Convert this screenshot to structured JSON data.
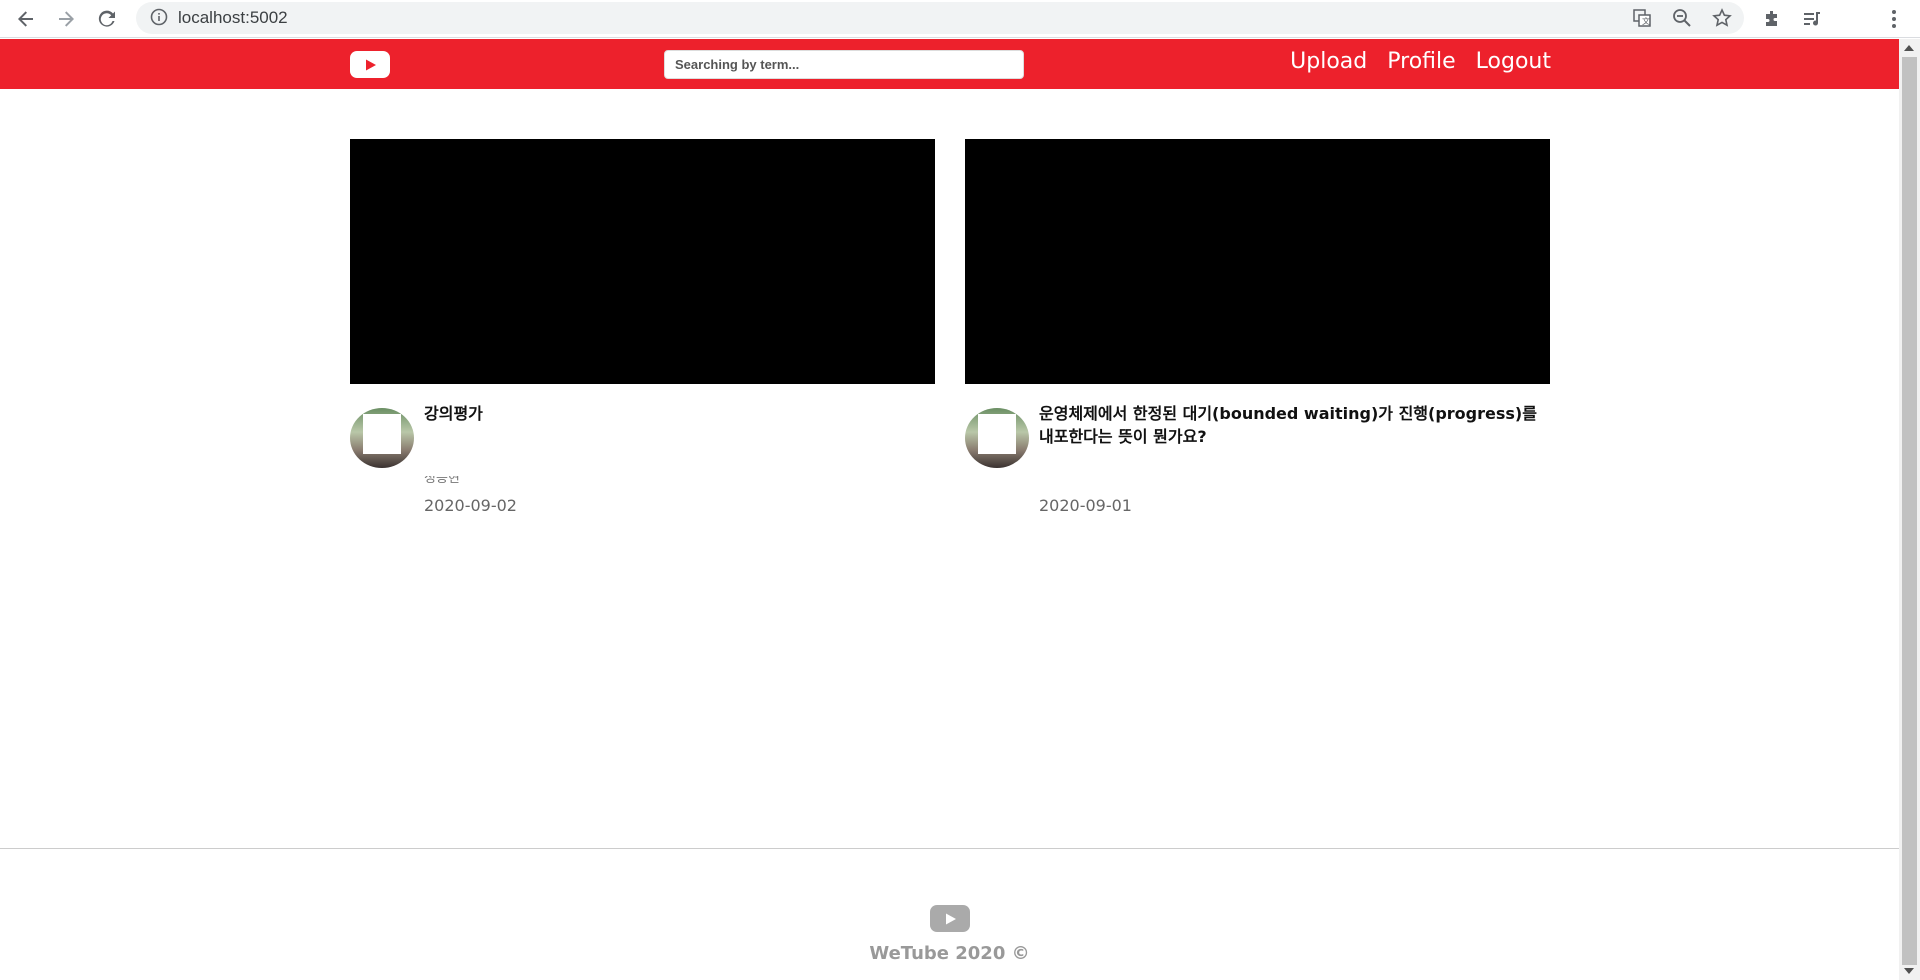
{
  "browser": {
    "url": "localhost:5002",
    "icons": [
      "back-icon",
      "forward-icon",
      "reload-icon",
      "info-icon",
      "translate-icon",
      "zoom-out-icon",
      "star-icon",
      "extensions-icon",
      "media-icon",
      "menu-icon"
    ]
  },
  "header": {
    "search_placeholder": "Searching by term...",
    "nav": {
      "upload": "Upload",
      "profile": "Profile",
      "logout": "Logout"
    },
    "accent_color": "#ed212c"
  },
  "videos": [
    {
      "title": "강의평가",
      "creator": "정승현",
      "date": "2020-09-02"
    },
    {
      "title": "운영체제에서 한정된 대기(bounded waiting)가 진행(progress)를 내포한다는 뜻이 뭔가요?",
      "creator": "",
      "date": "2020-09-01"
    }
  ],
  "footer": {
    "text": "WeTube 2020 ©"
  }
}
